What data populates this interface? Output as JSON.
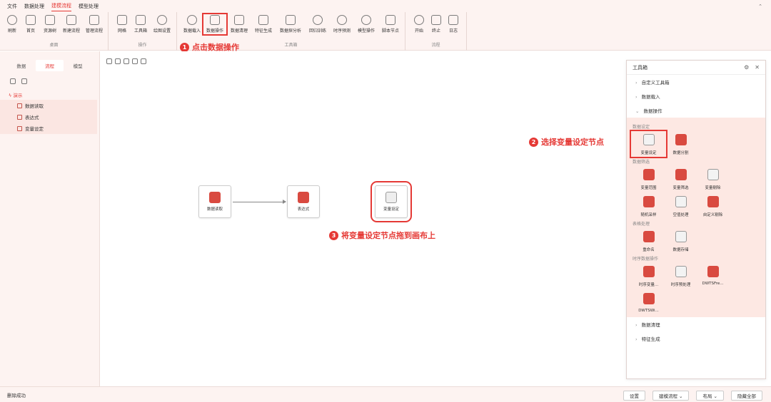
{
  "menu": {
    "items": [
      "文件",
      "数据处理",
      "建模流程",
      "模型处理"
    ],
    "active_index": 2
  },
  "ribbon": {
    "groups": [
      {
        "title": "桌面",
        "buttons": [
          "刷新",
          "首页",
          "资源树",
          "新建流程",
          "管理流程"
        ]
      },
      {
        "title": "操作",
        "buttons": [
          "网格",
          "工具箱",
          "绘图设置"
        ]
      },
      {
        "title": "工具箱",
        "buttons": [
          "数据载入",
          "数据操作",
          "数据清理",
          "特征生成",
          "数据探分析",
          "回归训练",
          "时序预测",
          "模型操作",
          "脚本节点"
        ]
      },
      {
        "title": "流程",
        "buttons": [
          "开始",
          "终止",
          "日志"
        ]
      }
    ],
    "highlighted": "数据操作"
  },
  "callouts": {
    "c1": {
      "num": "1",
      "text": "点击数据操作"
    },
    "c2": {
      "num": "2",
      "text": "选择变量设定节点"
    },
    "c3": {
      "num": "3",
      "text": "将变量设定节点拖到画布上"
    }
  },
  "left": {
    "tabs": [
      "数据",
      "流程",
      "模型"
    ],
    "active_tab": 1,
    "tree_root": "演示",
    "tree_items": [
      "数据读取",
      "表达式",
      "变量设定"
    ]
  },
  "canvas": {
    "nodes": [
      "数据读取",
      "表达式",
      "变量设定"
    ]
  },
  "toolbox": {
    "title": "工具箱",
    "top_categories": [
      "自定义工具箱",
      "数据载入"
    ],
    "open_category": "数据操作",
    "sections": [
      {
        "title": "数据设定",
        "items": [
          "变量设定",
          "数据分割"
        ]
      },
      {
        "title": "数据筛选",
        "items": [
          "变量范围",
          "变量筛选",
          "变量剔除",
          "随机采样",
          "空值处理",
          "自定义剔除"
        ]
      },
      {
        "title": "表格处理",
        "items": [
          "重命名",
          "数据存储"
        ]
      },
      {
        "title": "时序数据操作",
        "items": [
          "时序变量...",
          "时序预处理",
          "DWTSFre...",
          "DWTSWi..."
        ]
      }
    ],
    "bottom_categories": [
      "数据清理",
      "特征生成"
    ],
    "highlighted": "变量设定"
  },
  "status": {
    "message": "删除成功",
    "buttons": [
      "设置",
      "建模流程 ⌄",
      "布局 ⌄",
      "隐藏全部"
    ]
  },
  "colors": {
    "accent": "#e53935",
    "panel_bg": "#fdf3f1"
  }
}
